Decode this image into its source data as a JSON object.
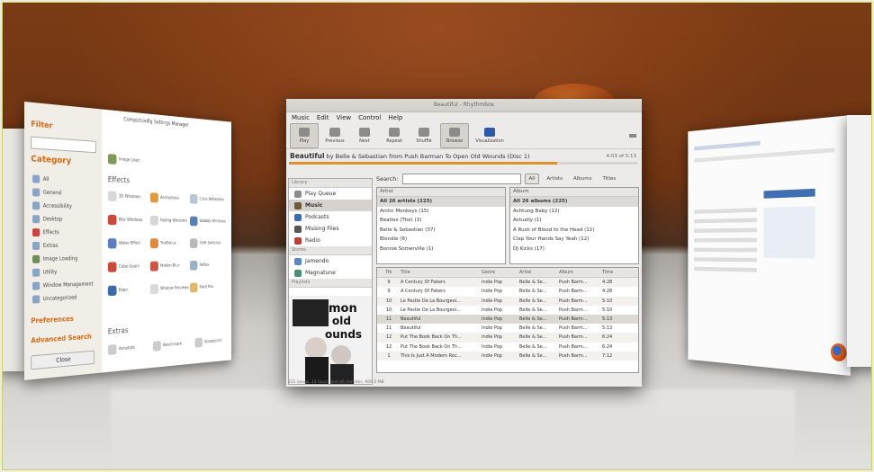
{
  "settings": {
    "title": "CompizConfig Settings Manager",
    "filter_label": "Filter",
    "category_label": "Category",
    "categories": [
      "All",
      "General",
      "Accessibility",
      "Desktop",
      "Effects",
      "Extras",
      "Image Loading",
      "Utility",
      "Window Management",
      "Uncategorized"
    ],
    "preferences_label": "Preferences",
    "advanced_search_label": "Advanced Search",
    "close_label": "Close",
    "section_top_item": "Image Load",
    "section_effects": "Effects",
    "section_extras": "Extras",
    "effect_plugins": [
      "3D Windows",
      "Animations",
      "Cube Reflection",
      "Blur Windows",
      "Fading Windows",
      "Wobbly Windows",
      "Water Effect",
      "Trailfocus",
      "Shift Switcher",
      "Cube Gears",
      "Motion Blur",
      "Reflex",
      "Expo",
      "Window Previews",
      "Paint fire"
    ],
    "extras_plugins": [
      "Annotate",
      "Benchmark",
      "Screenshot"
    ]
  },
  "rhythmbox": {
    "window_title": "Beautiful - Rhythmbox",
    "menu": [
      "Music",
      "Edit",
      "View",
      "Control",
      "Help"
    ],
    "toolbar": [
      {
        "label": "Play",
        "icon": "play-icon",
        "active": true
      },
      {
        "label": "Previous",
        "icon": "previous-icon",
        "active": false
      },
      {
        "label": "Next",
        "icon": "next-icon",
        "active": false
      },
      {
        "label": "Repeat",
        "icon": "repeat-icon",
        "active": false
      },
      {
        "label": "Shuffle",
        "icon": "shuffle-icon",
        "active": false
      },
      {
        "label": "Browse",
        "icon": "browse-icon",
        "active": true
      },
      {
        "label": "Visualization",
        "icon": "visualization-icon",
        "active": false
      }
    ],
    "now_playing": {
      "title": "Beautiful",
      "rest": " by Belle & Sebastian from Push Barman To Open Old Wounds (Disc 1)",
      "time": "4:03 of 5:13",
      "progress": 0.77
    },
    "sidebar": {
      "library_label": "Library",
      "library": [
        "Play Queue",
        "Music",
        "Podcasts",
        "Missing Files",
        "Radio"
      ],
      "stores_label": "Stores",
      "stores": [
        "Jamendo",
        "Magnatune"
      ],
      "playlists_label": "Playlists",
      "selected": "Music"
    },
    "album_art_text": "Push Barman to open old wounds",
    "search_label": "Search:",
    "filters": [
      "All",
      "Artists",
      "Albums",
      "Titles"
    ],
    "artist_pane": {
      "header": "Artist",
      "items": [
        "All 26 artists (225)",
        "Arctic Monkeys (15)",
        "Beatles (The) (3)",
        "Belle & Sebastian (37)",
        "Blondie (6)",
        "Bonnie Somerville (1)"
      ]
    },
    "album_pane": {
      "header": "Album",
      "items": [
        "All 26 albums (225)",
        "Achtung Baby (12)",
        "Actually (1)",
        "A Rush of Blood to the Head (11)",
        "Clap Your Hands Say Yeah (12)",
        "DJ Kicks (17)"
      ]
    },
    "track_headers": [
      "Trk",
      "Title",
      "Genre",
      "Artist",
      "Album",
      "Time"
    ],
    "tracks": [
      {
        "num": "9",
        "title": "A Century Of Fakers",
        "genre": "Indie Pop",
        "artist": "Belle & Se...",
        "album": "Push Barm...",
        "time": "4:28"
      },
      {
        "num": "9",
        "title": "A Century Of Fakers",
        "genre": "Indie Pop",
        "artist": "Belle & Se...",
        "album": "Push Barm...",
        "time": "4:28"
      },
      {
        "num": "10",
        "title": "Le Pastie De La Bourgeoi...",
        "genre": "Indie Pop",
        "artist": "Belle & Se...",
        "album": "Push Barm...",
        "time": "5:10"
      },
      {
        "num": "10",
        "title": "Le Pastie De La Bourgeoi...",
        "genre": "Indie Pop",
        "artist": "Belle & Se...",
        "album": "Push Barm...",
        "time": "5:10"
      },
      {
        "num": "11",
        "title": "Beautiful",
        "genre": "Indie Pop",
        "artist": "Belle & Se...",
        "album": "Push Barm...",
        "time": "5:13"
      },
      {
        "num": "11",
        "title": "Beautiful",
        "genre": "Indie Pop",
        "artist": "Belle & Se...",
        "album": "Push Barm...",
        "time": "5:13"
      },
      {
        "num": "12",
        "title": "Put The Book Back On Th...",
        "genre": "Indie Pop",
        "artist": "Belle & Se...",
        "album": "Push Barm...",
        "time": "6:24"
      },
      {
        "num": "12",
        "title": "Put The Book Back On Th...",
        "genre": "Indie Pop",
        "artist": "Belle & Se...",
        "album": "Push Barm...",
        "time": "6:24"
      },
      {
        "num": "1",
        "title": "This Is Just A Modern Roc...",
        "genre": "Indie Pop",
        "artist": "Belle & Se...",
        "album": "Push Barm...",
        "time": "7:12"
      }
    ],
    "current_track_index": 4,
    "status_text": "225 songs, 14 hours and 46 minutes, 909.0 MB"
  }
}
